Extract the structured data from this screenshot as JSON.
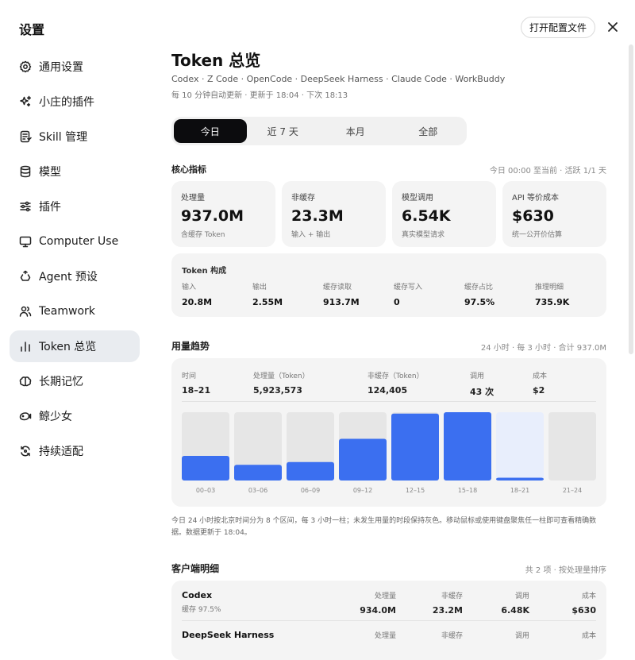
{
  "sidebar": {
    "title": "设置",
    "items": [
      {
        "label": "通用设置",
        "icon": "gear-icon"
      },
      {
        "label": "小庄的插件",
        "icon": "sparkle-icon"
      },
      {
        "label": "Skill 管理",
        "icon": "skill-doc-icon"
      },
      {
        "label": "模型",
        "icon": "database-icon"
      },
      {
        "label": "插件",
        "icon": "sliders-icon"
      },
      {
        "label": "Computer Use",
        "icon": "monitor-icon"
      },
      {
        "label": "Agent 预设",
        "icon": "recycle-icon"
      },
      {
        "label": "Teamwork",
        "icon": "users-icon"
      },
      {
        "label": "Token 总览",
        "icon": "bar-chart-icon",
        "active": true
      },
      {
        "label": "长期记忆",
        "icon": "brain-icon"
      },
      {
        "label": "鲸少女",
        "icon": "whale-icon"
      },
      {
        "label": "持续适配",
        "icon": "refresh-icon"
      }
    ]
  },
  "header": {
    "open_config_label": "打开配置文件",
    "close_icon": "close-icon"
  },
  "page": {
    "title": "Token 总览",
    "clients_line": "Codex · Z Code · OpenCode · DeepSeek Harness · Claude Code · WorkBuddy",
    "update_line": "每 10 分钟自动更新 · 更新于 18:04 · 下次 18:13"
  },
  "tabs": [
    {
      "label": "今日",
      "active": true
    },
    {
      "label": "近 7 天"
    },
    {
      "label": "本月"
    },
    {
      "label": "全部"
    }
  ],
  "core": {
    "title": "核心指标",
    "meta": "今日 00:00 至当前 · 活跃 1/1 天",
    "cards": [
      {
        "label": "处理量",
        "value": "937.0M",
        "sub": "含缓存 Token"
      },
      {
        "label": "非缓存",
        "value": "23.3M",
        "sub": "输入 + 输出"
      },
      {
        "label": "模型调用",
        "value": "6.54K",
        "sub": "真实模型请求"
      },
      {
        "label": "API 等价成本",
        "value": "$630",
        "sub": "统一公开价估算"
      }
    ]
  },
  "composition": {
    "title": "Token 构成",
    "items": [
      {
        "label": "输入",
        "value": "20.8M"
      },
      {
        "label": "输出",
        "value": "2.55M"
      },
      {
        "label": "缓存读取",
        "value": "913.7M"
      },
      {
        "label": "缓存写入",
        "value": "0"
      },
      {
        "label": "缓存占比",
        "value": "97.5%"
      },
      {
        "label": "推理明细",
        "value": "735.9K"
      }
    ]
  },
  "trend": {
    "title": "用量趋势",
    "meta": "24 小时 · 每 3 小时 · 合计 937.0M",
    "hover": [
      {
        "label": "时间",
        "value": "18–21"
      },
      {
        "label": "处理量（Token）",
        "value": "5,923,573"
      },
      {
        "label": "非缓存（Token）",
        "value": "124,405"
      },
      {
        "label": "调用",
        "value": "43 次"
      },
      {
        "label": "成本",
        "value": "$2"
      }
    ],
    "note": "今日 24 小时按北京时间分为 8 个区间，每 3 小时一柱；未发生用量的时段保持灰色。移动鼠标或使用键盘聚焦任一柱即可查看精确数据。数据更新于 18:04。"
  },
  "chart_data": {
    "type": "bar",
    "categories": [
      "00–03",
      "03–06",
      "06–09",
      "09–12",
      "12–15",
      "15–18",
      "18–21",
      "21–24"
    ],
    "values": [
      36,
      23,
      27,
      61,
      98,
      100,
      4,
      0
    ],
    "value_unit": "percent of max",
    "highlighted_category": "18–21",
    "colors": {
      "bar": "#3b6ff0",
      "track": "#e6e6e6",
      "highlight_track": "#e8eefc"
    }
  },
  "clients": {
    "title": "客户端明细",
    "meta": "共 2 项 · 按处理量排序",
    "rows": [
      {
        "name": "Codex",
        "cache": "缓存 97.5%",
        "cols": [
          {
            "label": "处理量",
            "value": "934.0M"
          },
          {
            "label": "非缓存",
            "value": "23.2M"
          },
          {
            "label": "调用",
            "value": "6.48K"
          },
          {
            "label": "成本",
            "value": "$630"
          }
        ]
      },
      {
        "name": "DeepSeek Harness",
        "cache": "",
        "cols": [
          {
            "label": "处理量",
            "value": ""
          },
          {
            "label": "非缓存",
            "value": ""
          },
          {
            "label": "调用",
            "value": ""
          },
          {
            "label": "成本",
            "value": ""
          }
        ]
      }
    ]
  }
}
